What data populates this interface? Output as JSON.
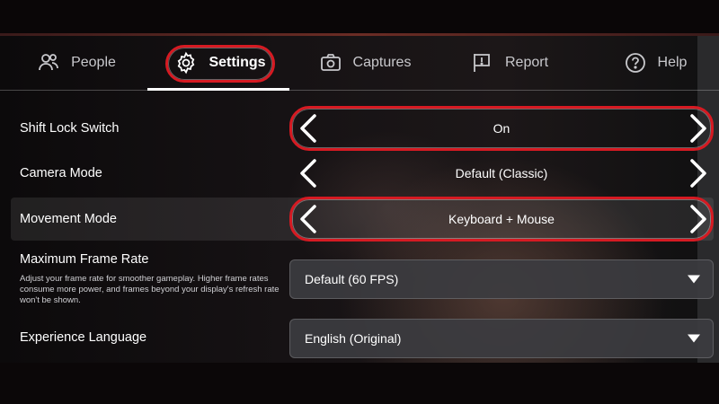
{
  "tabs": [
    {
      "id": "people",
      "label": "People",
      "icon": "people-icon"
    },
    {
      "id": "settings",
      "label": "Settings",
      "icon": "gear-icon",
      "active": true
    },
    {
      "id": "captures",
      "label": "Captures",
      "icon": "camera-icon"
    },
    {
      "id": "report",
      "label": "Report",
      "icon": "flag-icon"
    },
    {
      "id": "help",
      "label": "Help",
      "icon": "question-icon"
    }
  ],
  "settings": {
    "shift_lock": {
      "label": "Shift Lock Switch",
      "value": "On"
    },
    "camera_mode": {
      "label": "Camera Mode",
      "value": "Default (Classic)"
    },
    "movement_mode": {
      "label": "Movement Mode",
      "value": "Keyboard + Mouse"
    },
    "frame_rate": {
      "label": "Maximum Frame Rate",
      "description": "Adjust your frame rate for smoother gameplay. Higher frame rates consume more power, and frames beyond your display's refresh rate won't be shown.",
      "value": "Default (60 FPS)"
    },
    "language": {
      "label": "Experience Language",
      "value": "English (Original)"
    }
  },
  "colors": {
    "highlight": "#d61a22",
    "text": "#ffffff",
    "inactive_tab": "#c8c8cc",
    "dropdown_bg": "#3c3c40"
  }
}
